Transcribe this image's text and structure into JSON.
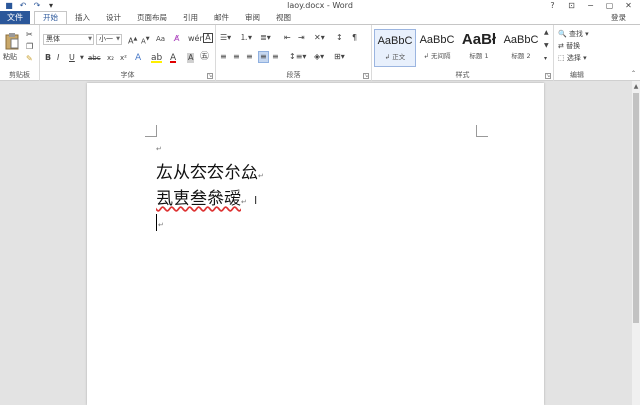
{
  "window": {
    "title": "laoy.docx - Word",
    "help": "?",
    "ribbon_display": "⊡",
    "minimize": "−",
    "restore": "▢",
    "close": "✕"
  },
  "qat": {
    "save": "💾",
    "undo": "↶",
    "redo": "↷",
    "customize": "▾"
  },
  "tabs": {
    "file": "文件",
    "items": [
      "开始",
      "插入",
      "设计",
      "页面布局",
      "引用",
      "邮件",
      "审阅",
      "视图"
    ],
    "login": "登录"
  },
  "ribbon": {
    "clipboard": {
      "label": "剪贴板",
      "paste": "粘贴"
    },
    "font": {
      "label": "字体",
      "name": "黑体",
      "size": "小一",
      "grow": "A",
      "shrink": "A",
      "case": "Aa",
      "clear": "A",
      "bold": "B",
      "italic": "I",
      "underline": "U",
      "strike": "abc",
      "sub": "x₂",
      "sup": "x²"
    },
    "paragraph": {
      "label": "段落"
    },
    "styles": {
      "label": "样式",
      "items": [
        {
          "preview": "AaBbC",
          "name": "↲ 正文"
        },
        {
          "preview": "AaBbC",
          "name": "↲ 无间隔"
        },
        {
          "preview": "AaBł",
          "name": "标题 1"
        },
        {
          "preview": "AaBbC",
          "name": "标题 2"
        }
      ]
    },
    "editing": {
      "label": "编辑",
      "find": "查找",
      "replace": "替换",
      "select": "选择"
    }
  },
  "document": {
    "lines": [
      "厷从厺厺厼厽",
      "厾叀叁叅叆"
    ],
    "para_mark": "↵"
  },
  "colors": {
    "accent": "#2b579a",
    "highlight": "#ffef00",
    "font_color": "#e00000"
  }
}
